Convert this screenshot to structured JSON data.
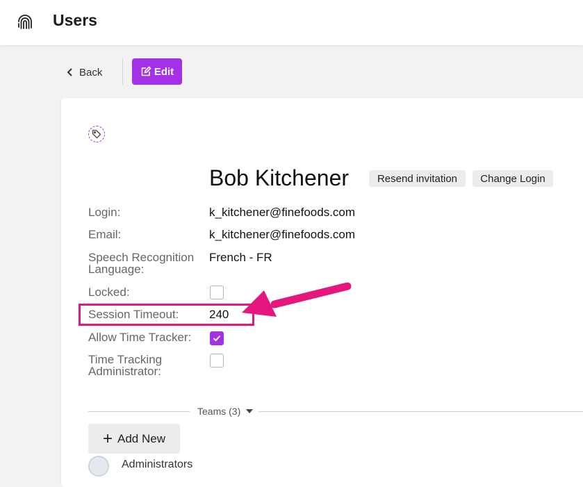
{
  "header": {
    "title": "Users",
    "logo_icon": "fingerprint-icon"
  },
  "toolbar": {
    "back_label": "Back",
    "edit_label": "Edit",
    "edit_color": "#a431e6"
  },
  "user": {
    "name": "Bob Kitchener",
    "resend_label": "Resend invitation",
    "change_login_label": "Change Login"
  },
  "fields": {
    "login": {
      "label": "Login:",
      "value": "k_kitchener@finefoods.com"
    },
    "email": {
      "label": "Email:",
      "value": "k_kitchener@finefoods.com"
    },
    "speech_language": {
      "label": "Speech Recognition Language:",
      "value": "French - FR"
    },
    "locked": {
      "label": "Locked:",
      "checked": false
    },
    "session_timeout": {
      "label": "Session Timeout:",
      "value": "240"
    },
    "allow_time_tracker": {
      "label": "Allow Time Tracker:",
      "checked": true
    },
    "time_tracking_admin": {
      "label": "Time Tracking Administrator:",
      "checked": false
    }
  },
  "annotation": {
    "highlight_color": "#e5177f"
  },
  "teams": {
    "label": "Teams (3)",
    "add_new_label": "Add New",
    "first_team_name": "Administrators"
  }
}
